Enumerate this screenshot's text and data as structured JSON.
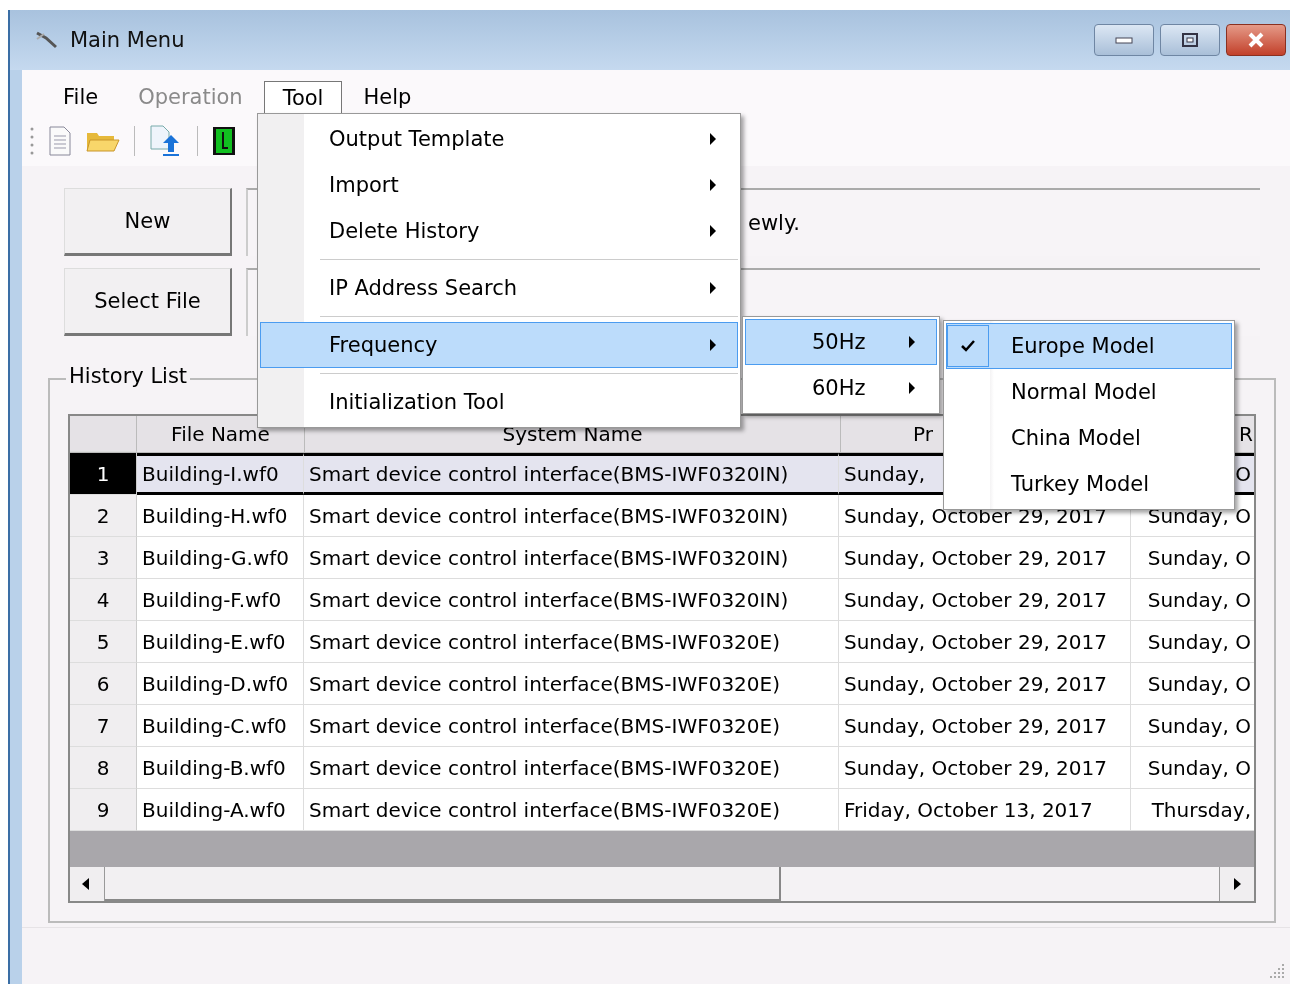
{
  "window": {
    "title": "Main Menu"
  },
  "menu_bar": [
    {
      "label": "File",
      "disabled": false,
      "open": false
    },
    {
      "label": "Operation",
      "disabled": true,
      "open": false
    },
    {
      "label": "Tool",
      "disabled": false,
      "open": true
    },
    {
      "label": "Help",
      "disabled": false,
      "open": false
    }
  ],
  "buttons": [
    "New",
    "Select File"
  ],
  "info_text": "ewly.",
  "history_list": {
    "title": "History List",
    "columns": [
      "File Name",
      "System Name",
      "Pr",
      "R"
    ],
    "rows": [
      {
        "number": "1",
        "selected": true,
        "cells": [
          "Building-I.wf0",
          "Smart device control interface(BMS-IWF0320IN)",
          "Sunday,",
          "O"
        ]
      },
      {
        "number": "2",
        "selected": false,
        "cells": [
          "Building-H.wf0",
          "Smart device control interface(BMS-IWF0320IN)",
          "Sunday, October 29, 2017",
          "Sunday, O"
        ]
      },
      {
        "number": "3",
        "selected": false,
        "cells": [
          "Building-G.wf0",
          "Smart device control interface(BMS-IWF0320IN)",
          "Sunday, October 29, 2017",
          "Sunday, O"
        ]
      },
      {
        "number": "4",
        "selected": false,
        "cells": [
          "Building-F.wf0",
          "Smart device control interface(BMS-IWF0320IN)",
          "Sunday, October 29, 2017",
          "Sunday, O"
        ]
      },
      {
        "number": "5",
        "selected": false,
        "cells": [
          "Building-E.wf0",
          "Smart device control interface(BMS-IWF0320E)",
          "Sunday, October 29, 2017",
          "Sunday, O"
        ]
      },
      {
        "number": "6",
        "selected": false,
        "cells": [
          "Building-D.wf0",
          "Smart device control interface(BMS-IWF0320E)",
          "Sunday, October 29, 2017",
          "Sunday, O"
        ]
      },
      {
        "number": "7",
        "selected": false,
        "cells": [
          "Building-C.wf0",
          "Smart device control interface(BMS-IWF0320E)",
          "Sunday, October 29, 2017",
          "Sunday, O"
        ]
      },
      {
        "number": "8",
        "selected": false,
        "cells": [
          "Building-B.wf0",
          "Smart device control interface(BMS-IWF0320E)",
          "Sunday, October 29, 2017",
          "Sunday, O"
        ]
      },
      {
        "number": "9",
        "selected": false,
        "cells": [
          "Building-A.wf0",
          "Smart device control interface(BMS-IWF0320E)",
          "Friday, October 13, 2017",
          "Thursday,"
        ]
      }
    ]
  },
  "tool_menu": {
    "items": [
      {
        "kind": "submenu",
        "label": "Output Template",
        "highlighted": false
      },
      {
        "kind": "submenu",
        "label": "Import",
        "highlighted": false
      },
      {
        "kind": "submenu",
        "label": "Delete History",
        "highlighted": false
      },
      {
        "kind": "separator"
      },
      {
        "kind": "submenu",
        "label": "IP Address Search",
        "highlighted": false
      },
      {
        "kind": "separator"
      },
      {
        "kind": "submenu",
        "label": "Frequency",
        "highlighted": true
      },
      {
        "kind": "separator"
      },
      {
        "kind": "command",
        "label": "Initialization Tool",
        "highlighted": false
      }
    ]
  },
  "frequency_menu": {
    "items": [
      {
        "label": "50Hz",
        "highlighted": true
      },
      {
        "label": "60Hz",
        "highlighted": false
      }
    ]
  },
  "model_menu": {
    "items": [
      {
        "label": "Europe Model",
        "checked": true,
        "highlighted": true
      },
      {
        "label": "Normal Model",
        "checked": false,
        "highlighted": false
      },
      {
        "label": "China Model",
        "checked": false,
        "highlighted": false
      },
      {
        "label": "Turkey Model",
        "checked": false,
        "highlighted": false
      }
    ]
  }
}
